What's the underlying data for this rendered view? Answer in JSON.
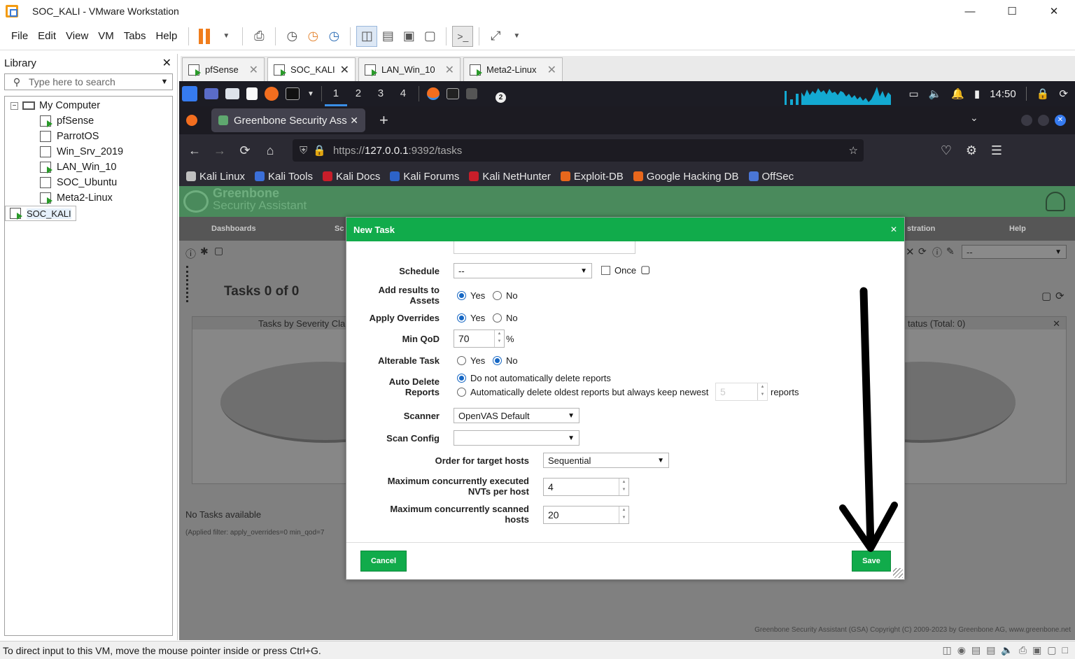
{
  "window": {
    "title": "SOC_KALI - VMware Workstation"
  },
  "menu": [
    "File",
    "Edit",
    "View",
    "VM",
    "Tabs",
    "Help"
  ],
  "library": {
    "title": "Library",
    "search_placeholder": "Type here to search",
    "root": "My Computer",
    "vms": [
      {
        "name": "pfSense",
        "running": true
      },
      {
        "name": "ParrotOS",
        "running": false
      },
      {
        "name": "Win_Srv_2019",
        "running": false
      },
      {
        "name": "LAN_Win_10",
        "running": true
      },
      {
        "name": "SOC_Ubuntu",
        "running": false
      },
      {
        "name": "Meta2-Linux",
        "running": true
      },
      {
        "name": "SOC_KALI",
        "running": true
      }
    ]
  },
  "vm_tabs": [
    {
      "label": "pfSense",
      "active": false
    },
    {
      "label": "SOC_KALI",
      "active": true
    },
    {
      "label": "LAN_Win_10",
      "active": false
    },
    {
      "label": "Meta2-Linux",
      "active": false
    }
  ],
  "kali": {
    "workspaces": [
      "1",
      "2",
      "3",
      "4"
    ],
    "clock": "14:50",
    "badge": "2"
  },
  "firefox": {
    "tab_title": "Greenbone Security Assis",
    "url_prefix": "https://",
    "url_host": "127.0.0.1",
    "url_rest": ":9392/tasks",
    "bookmarks": [
      {
        "label": "Kali Linux",
        "color": "#bfbfbf"
      },
      {
        "label": "Kali Tools",
        "color": "#3b6fd8"
      },
      {
        "label": "Kali Docs",
        "color": "#c81e2a"
      },
      {
        "label": "Kali Forums",
        "color": "#2d63c8"
      },
      {
        "label": "Kali NetHunter",
        "color": "#c81e2a"
      },
      {
        "label": "Exploit-DB",
        "color": "#e8671c"
      },
      {
        "label": "Google Hacking DB",
        "color": "#e8671c"
      },
      {
        "label": "OffSec",
        "color": "#4a76d6"
      }
    ]
  },
  "gsa": {
    "logo_line1": "Greenbone",
    "logo_line2": "Security Assistant",
    "menu_dashboards": "Dashboards",
    "menu_scans": "Sc",
    "menu_administration": "stration",
    "menu_help": "Help",
    "filter_value": "--",
    "tasks_heading": "Tasks 0 of 0",
    "severity_chart_title": "Tasks by Severity Cla",
    "status_chart_title": "tatus (Total: 0)",
    "no_tasks": "No Tasks available",
    "applied_filter": "(Applied filter: apply_overrides=0 min_qod=7",
    "footer": "Greenbone Security Assistant (GSA) Copyright (C) 2009-2023 by Greenbone AG, www.greenbone.net"
  },
  "dialog": {
    "title": "New Task",
    "schedule_label": "Schedule",
    "schedule_value": "--",
    "once_label": "Once",
    "add_results_label": "Add results to Assets",
    "apply_overrides_label": "Apply Overrides",
    "min_qod_label": "Min QoD",
    "min_qod_value": "70",
    "min_qod_unit": "%",
    "alterable_label": "Alterable Task",
    "yes": "Yes",
    "no": "No",
    "auto_delete_label": "Auto Delete Reports",
    "auto_delete_opt1": "Do not automatically delete reports",
    "auto_delete_opt2": "Automatically delete oldest reports but always keep newest",
    "keep_value": "5",
    "reports_suffix": "reports",
    "scanner_label": "Scanner",
    "scanner_value": "OpenVAS Default",
    "scan_config_label": "Scan Config",
    "scan_config_value": "",
    "order_label": "Order for target hosts",
    "order_value": "Sequential",
    "max_nvts_label": "Maximum concurrently executed NVTs per host",
    "max_nvts_value": "4",
    "max_hosts_label": "Maximum concurrently scanned hosts",
    "max_hosts_value": "20",
    "cancel": "Cancel",
    "save": "Save"
  },
  "statusbar": {
    "text": "To direct input to this VM, move the mouse pointer inside or press Ctrl+G."
  }
}
